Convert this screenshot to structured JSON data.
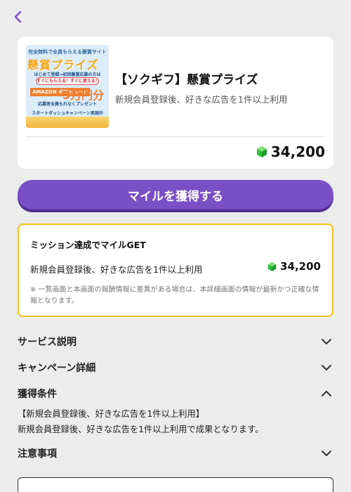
{
  "header": {
    "back_icon": "chevron-left-icon",
    "accent": "#7b4fc6"
  },
  "offer": {
    "banner": {
      "top_line": "完全無料で全員もらえる懸賞サイト",
      "title": "懸賞プライズ",
      "sub_line": "はじめて登録→初回懸賞応募の方は",
      "pill": "すぐにもらえる！すぐに使える！",
      "amazon": "AMAZON ギフトカード",
      "amount": "5万円分",
      "gift_line": "応募者全員もれなくプレゼント",
      "dash_line": "スタートダッシュキャンペーン実施中"
    },
    "title": "【ソクギフ】懸賞プライズ",
    "description": "新規会員登録後、好きな広告を1件以上利用",
    "points": "34,200",
    "gem_color": "#2fbf3a"
  },
  "cta": {
    "label": "マイルを獲得する"
  },
  "mission": {
    "title": "ミッション達成でマイルGET",
    "description": "新規会員登録後、好きな広告を1件以上利用",
    "points": "34,200",
    "note": "※ 一覧画面と本画面の報酬情報に差異がある場合は、本詳細画面の情報が最新かつ正確な情報となります。",
    "border_color": "#f2c21b"
  },
  "sections": {
    "service": {
      "label": "サービス説明",
      "expanded": false
    },
    "campaign": {
      "label": "キャンペーン詳細",
      "expanded": false
    },
    "conditions": {
      "label": "獲得条件",
      "expanded": true,
      "detail_line1": "【新規会員登録後、好きな広告を1件以上利用】",
      "detail_line2": "新規会員登録後、好きな広告を1件以上利用で成果となります。"
    },
    "notes": {
      "label": "注意事項",
      "expanded": false
    }
  }
}
